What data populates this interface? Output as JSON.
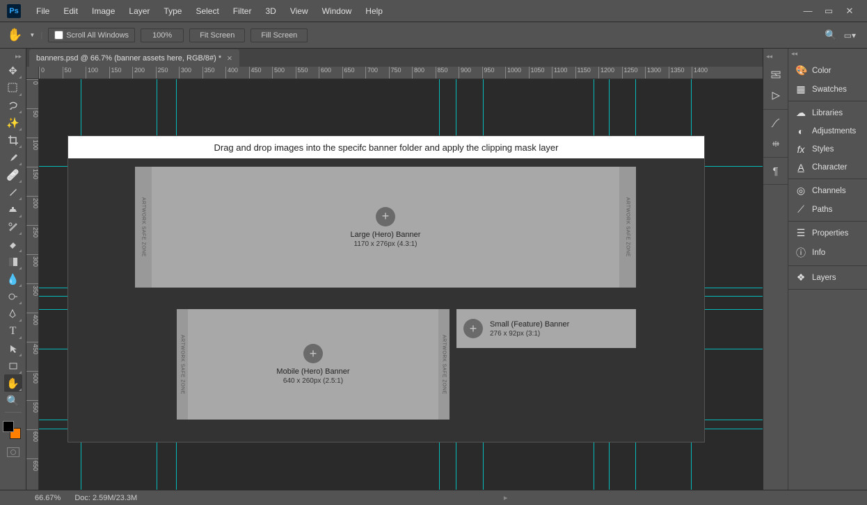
{
  "app": {
    "logo": "Ps"
  },
  "menu": [
    "File",
    "Edit",
    "Image",
    "Layer",
    "Type",
    "Select",
    "Filter",
    "3D",
    "View",
    "Window",
    "Help"
  ],
  "options": {
    "scroll_all": "Scroll All Windows",
    "zoom": "100%",
    "fit_screen": "Fit Screen",
    "fill_screen": "Fill Screen"
  },
  "document": {
    "tab_title": "banners.psd @ 66.7% (banner assets here, RGB/8#) *"
  },
  "rulers": {
    "h": [
      "0",
      "50",
      "100",
      "150",
      "200",
      "250",
      "300",
      "350",
      "400",
      "450",
      "500",
      "550",
      "600",
      "650",
      "700",
      "750",
      "800",
      "850",
      "900",
      "950",
      "1000",
      "1050",
      "1100",
      "1150",
      "1200",
      "1250",
      "1300",
      "1350",
      "1400"
    ],
    "v": [
      "0",
      "50",
      "100",
      "150",
      "200",
      "250",
      "300",
      "350",
      "400",
      "450",
      "500",
      "550",
      "600",
      "650"
    ]
  },
  "canvas": {
    "instruction": "Drag and drop images into the specifc banner folder and apply the clipping mask layer",
    "safezone": "ARTWORK SAFE ZONE",
    "banners": {
      "large": {
        "title": "Large (Hero) Banner",
        "dims": "1170 x 276px (4.3:1)"
      },
      "mobile": {
        "title": "Mobile (Hero) Banner",
        "dims": "640 x 260px (2.5:1)"
      },
      "small": {
        "title": "Small (Feature) Banner",
        "dims": "276 x 92px (3:1)"
      }
    }
  },
  "panels": {
    "groups": [
      [
        "Color",
        "Swatches"
      ],
      [
        "Libraries",
        "Adjustments",
        "Styles",
        "Character"
      ],
      [
        "Channels",
        "Paths"
      ],
      [
        "Properties",
        "Info"
      ],
      [
        "Layers"
      ]
    ]
  },
  "status": {
    "zoom": "66.67%",
    "doc": "Doc: 2.59M/23.3M"
  }
}
